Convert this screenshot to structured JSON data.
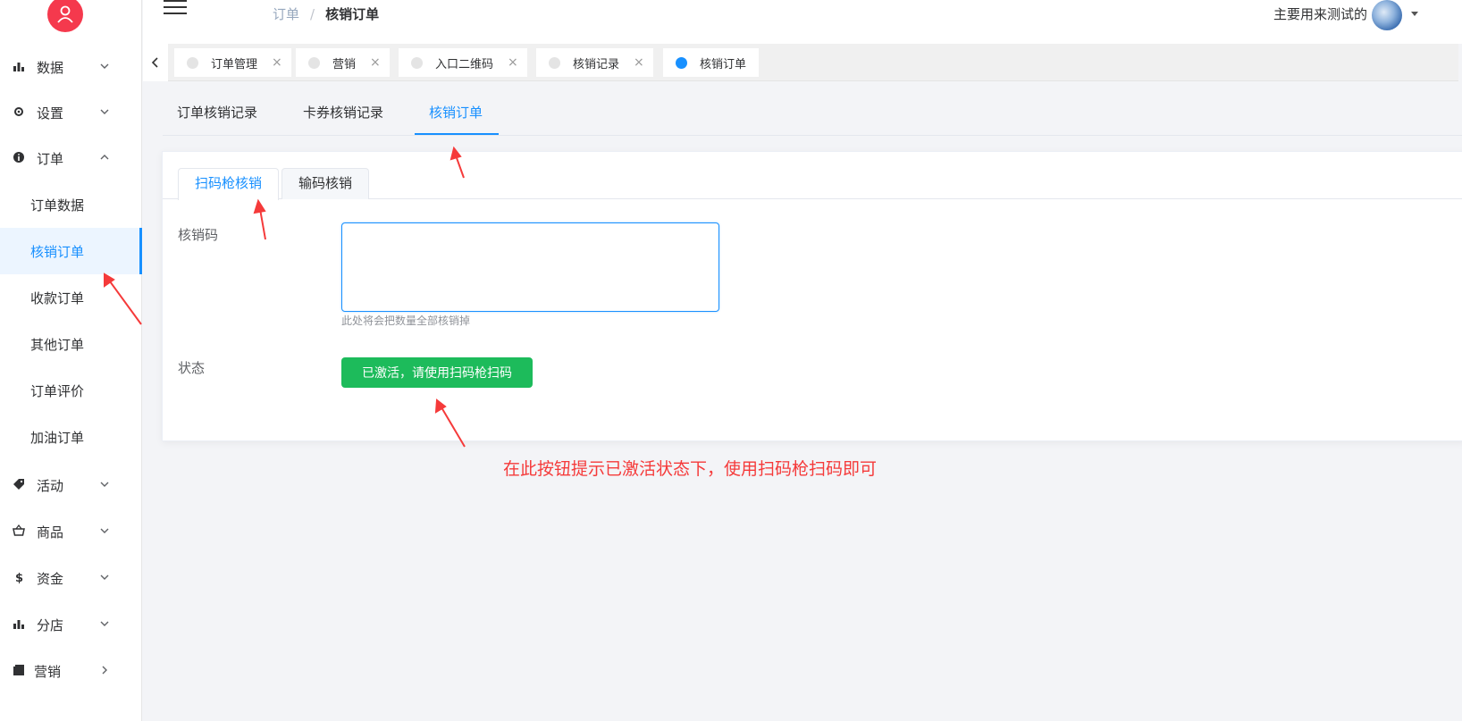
{
  "header": {
    "breadcrumb": [
      "订单",
      "核销订单"
    ],
    "breadcrumb_separator": "/",
    "user_name": "主要用来测试的"
  },
  "sidebar": {
    "items": [
      {
        "label": "数据",
        "icon": "bar-chart-icon",
        "arrow": "chevron-down"
      },
      {
        "label": "设置",
        "icon": "gear-icon",
        "arrow": "chevron-down"
      },
      {
        "label": "订单",
        "icon": "info-circle-icon",
        "arrow": "chevron-up"
      },
      {
        "label": "活动",
        "icon": "tag-icon",
        "arrow": "chevron-down"
      },
      {
        "label": "商品",
        "icon": "basket-icon",
        "arrow": "chevron-down"
      },
      {
        "label": "资金",
        "icon": "dollar-icon",
        "arrow": "chevron-down"
      },
      {
        "label": "分店",
        "icon": "bar-chart-icon",
        "arrow": "chevron-down"
      },
      {
        "label": "营销",
        "icon": "folder-icon",
        "arrow": "chevron-right"
      }
    ],
    "order_subitems": [
      "订单数据",
      "核销订单",
      "收款订单",
      "其他订单",
      "订单评价",
      "加油订单"
    ],
    "active_subitem": "核销订单"
  },
  "tags": [
    {
      "label": "订单管理",
      "active": false
    },
    {
      "label": "营销",
      "active": false
    },
    {
      "label": "入口二维码",
      "active": false
    },
    {
      "label": "核销记录",
      "active": false
    },
    {
      "label": "核销订单",
      "active": true
    }
  ],
  "tag_close_glyph": "×",
  "top_tabs": [
    "订单核销记录",
    "卡券核销记录",
    "核销订单"
  ],
  "active_top_tab": "核销订单",
  "card_tabs": [
    "扫码枪核销",
    "输码核销"
  ],
  "active_card_tab": "扫码枪核销",
  "form": {
    "code_label": "核销码",
    "code_value": "",
    "code_help": "此处将会把数量全部核销掉",
    "status_label": "状态",
    "status_button": "已激活，请使用扫码枪扫码"
  },
  "annotation": "在此按钮提示已激活状态下，使用扫码枪扫码即可",
  "colors": {
    "primary": "#1890ff",
    "success": "#1dbb5b",
    "annotation": "#f53a3a",
    "logo": "#f5394d"
  }
}
